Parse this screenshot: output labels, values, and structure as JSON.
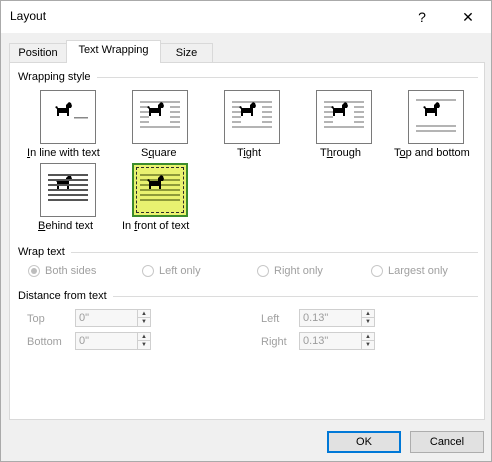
{
  "window": {
    "title": "Layout",
    "help_glyph": "?",
    "close_glyph": "✕"
  },
  "tabs": [
    {
      "label": "Position",
      "active": false
    },
    {
      "label": "Text Wrapping",
      "active": true
    },
    {
      "label": "Size",
      "active": false
    }
  ],
  "wrapping_style": {
    "heading": "Wrapping style",
    "options": [
      {
        "label": "In line with text",
        "mnemonic_index": 0,
        "icon": "inline-with-text-icon",
        "selected": false
      },
      {
        "label": "Square",
        "mnemonic_index": 1,
        "icon": "square-wrap-icon",
        "selected": false
      },
      {
        "label": "Tight",
        "mnemonic_index": 1,
        "icon": "tight-wrap-icon",
        "selected": false
      },
      {
        "label": "Through",
        "mnemonic_index": 1,
        "icon": "through-wrap-icon",
        "selected": false
      },
      {
        "label": "Top and bottom",
        "mnemonic_index": 1,
        "icon": "top-bottom-wrap-icon",
        "selected": false
      },
      {
        "label": "Behind text",
        "mnemonic_index": 0,
        "icon": "behind-text-icon",
        "selected": false
      },
      {
        "label": "In front of text",
        "mnemonic_index": 3,
        "icon": "in-front-of-text-icon",
        "selected": true
      }
    ]
  },
  "wrap_text": {
    "heading": "Wrap text",
    "options": [
      {
        "label": "Both sides",
        "checked": true,
        "enabled": false
      },
      {
        "label": "Left only",
        "checked": false,
        "enabled": false
      },
      {
        "label": "Right only",
        "checked": false,
        "enabled": false
      },
      {
        "label": "Largest only",
        "checked": false,
        "enabled": false
      }
    ]
  },
  "distance": {
    "heading": "Distance from text",
    "top": {
      "label": "Top",
      "value": "0\""
    },
    "bottom": {
      "label": "Bottom",
      "value": "0\""
    },
    "left": {
      "label": "Left",
      "value": "0.13\""
    },
    "right": {
      "label": "Right",
      "value": "0.13\""
    }
  },
  "buttons": {
    "ok": "OK",
    "cancel": "Cancel"
  },
  "colors": {
    "selected_fill": "#e9f270",
    "selected_border": "#3c8c2c",
    "default_button_border": "#0078d7"
  }
}
